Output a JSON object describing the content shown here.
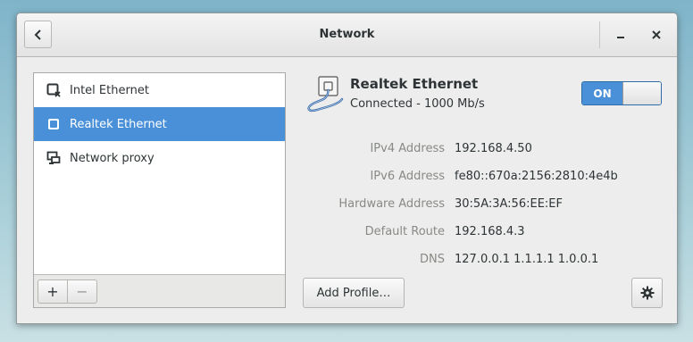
{
  "window": {
    "title": "Network"
  },
  "sidebar": {
    "items": [
      {
        "label": "Intel Ethernet",
        "icon": "ethernet-disconnected-icon",
        "selected": false
      },
      {
        "label": "Realtek Ethernet",
        "icon": "ethernet-icon",
        "selected": true
      },
      {
        "label": "Network proxy",
        "icon": "network-proxy-icon",
        "selected": false
      }
    ],
    "add_label": "+",
    "remove_label": "−"
  },
  "details": {
    "device_name": "Realtek Ethernet",
    "status": "Connected - 1000 Mb/s",
    "switch_label": "ON",
    "switch_state": true,
    "properties": [
      {
        "label": "IPv4 Address",
        "value": "192.168.4.50"
      },
      {
        "label": "IPv6 Address",
        "value": "fe80::670a:2156:2810:4e4b"
      },
      {
        "label": "Hardware Address",
        "value": "30:5A:3A:56:EE:EF"
      },
      {
        "label": "Default Route",
        "value": "192.168.4.3"
      },
      {
        "label": "DNS",
        "value": "127.0.0.1 1.1.1.1 1.0.0.1"
      }
    ],
    "add_profile_label": "Add Profile…"
  },
  "colors": {
    "accent": "#4a90d9",
    "window_bg": "#ededed",
    "label_gray": "#888a85",
    "text": "#2e3436"
  }
}
